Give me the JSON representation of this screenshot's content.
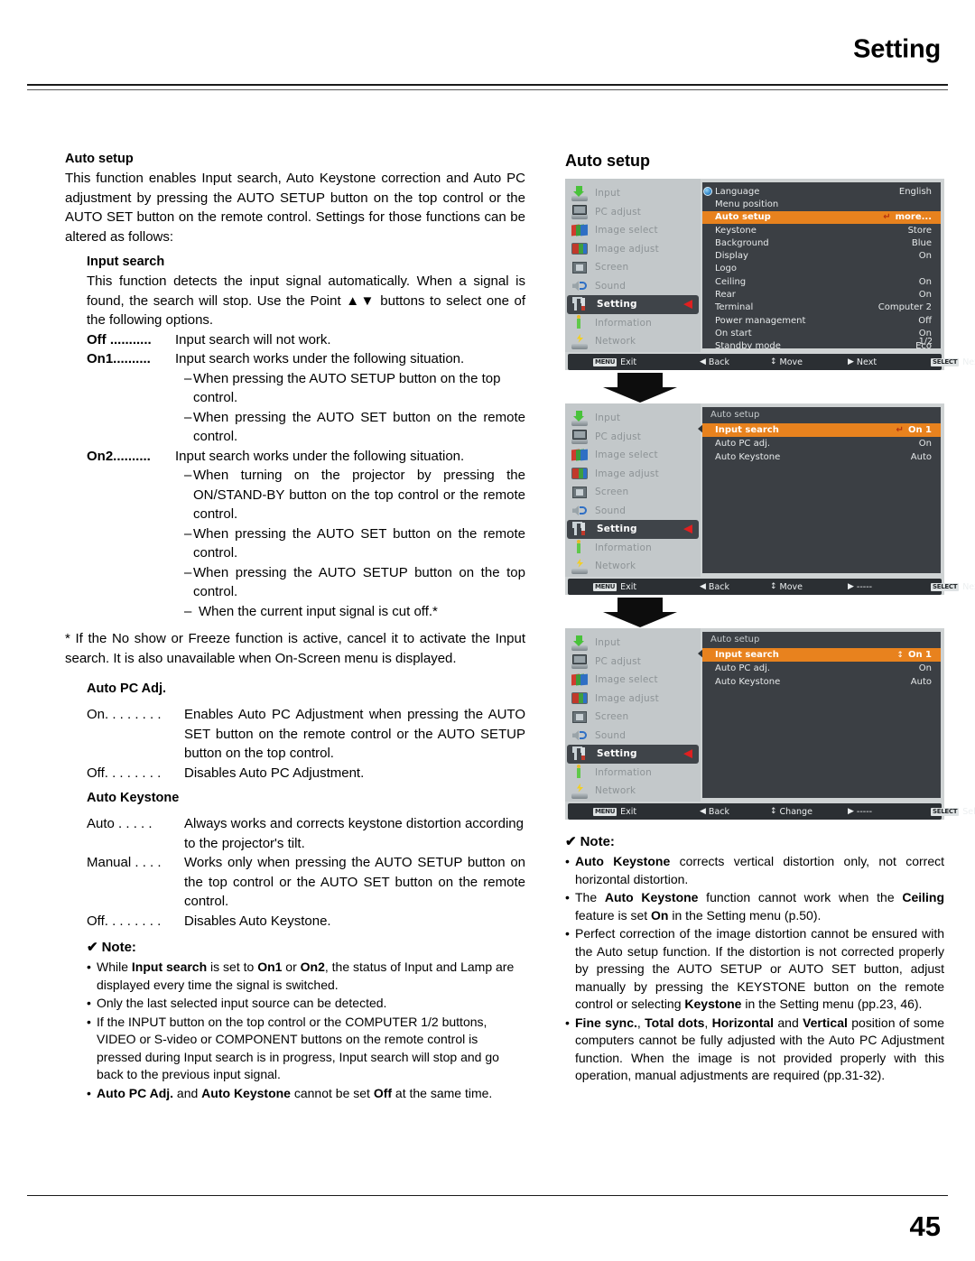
{
  "header": {
    "title": "Setting"
  },
  "footer": {
    "page_number": "45"
  },
  "left": {
    "heading": "Auto setup",
    "intro": "This function enables Input search, Auto Keystone correction and Auto PC adjustment by pressing the AUTO SETUP button on the top control or the AUTO SET button on the remote control. Settings for those functions can be altered as follows:",
    "input_search": {
      "heading": "Input search",
      "body": "This function detects the input signal automatically. When a signal is found, the search will stop. Use the Point ▲▼ buttons to select one of the following options.",
      "off_term": "Off ...........",
      "off_desc": "Input search will not work.",
      "on1_term": "On1..........",
      "on1_desc": "Input search works under the following situation.",
      "on1_items": [
        "When pressing the AUTO SETUP button on the top control.",
        "When pressing the AUTO SET button on the remote control."
      ],
      "on2_term": "On2..........",
      "on2_desc": "Input search works under the following situation.",
      "on2_items": [
        "When turning on the projector by pressing the ON/STAND-BY button on the top control or the remote control.",
        "When pressing the AUTO SET button on the remote control.",
        "When pressing the AUTO SETUP button on the top control.",
        "When the current input signal is cut off.*"
      ],
      "footnote": "* If the No show or Freeze function is active, cancel it to activate the Input search. It is also unavailable when On-Screen menu is displayed."
    },
    "auto_pc_adj": {
      "heading": "Auto PC Adj.",
      "on_term": "On. . . . . . . .",
      "on_desc": "Enables Auto PC Adjustment when pressing the AUTO SET button on the remote control or the AUTO SETUP button on the top control.",
      "off_term": "Off. . . . . . . .",
      "off_desc": "Disables Auto PC Adjustment."
    },
    "auto_keystone": {
      "heading": "Auto Keystone",
      "auto_term": "Auto . . . . .",
      "auto_desc": "Always works and corrects keystone distortion according to the projector's tilt.",
      "manual_term": "Manual . . . .",
      "manual_desc": "Works only when pressing the AUTO SETUP button on the top control or the AUTO SET button on the remote control.",
      "off_term": "Off. . . . . . . .",
      "off_desc": "Disables Auto Keystone."
    },
    "note": {
      "check": "✔",
      "heading": "Note:",
      "bullet_mark": "•",
      "items": [
        "While <b>Input search</b> is set to <b>On1</b> or <b>On2</b>, the status of Input and Lamp are displayed every time the signal is switched.",
        "Only the last selected input source can be detected.",
        "If the INPUT button on the top control or the COMPUTER 1/2 buttons, VIDEO or S-video or COMPONENT buttons on the remote control is pressed during Input search is in progress, Input search will stop and go back to the previous input signal.",
        "<b>Auto PC Adj.</b> and <b>Auto Keystone</b> cannot be set <b>Off</b> at the same time."
      ]
    }
  },
  "right": {
    "title": "Auto setup",
    "sidebar": [
      {
        "label": "Input",
        "icon": "input-icon",
        "selected": false
      },
      {
        "label": "PC adjust",
        "icon": "pc-adjust-icon",
        "selected": false
      },
      {
        "label": "Image select",
        "icon": "image-select-icon",
        "selected": false
      },
      {
        "label": "Image adjust",
        "icon": "image-adjust-icon",
        "selected": false
      },
      {
        "label": "Screen",
        "icon": "screen-icon",
        "selected": false
      },
      {
        "label": "Sound",
        "icon": "sound-icon",
        "selected": false
      },
      {
        "label": "Setting",
        "icon": "setting-icon",
        "selected": true
      },
      {
        "label": "Information",
        "icon": "information-icon",
        "selected": false
      },
      {
        "label": "Network",
        "icon": "network-icon",
        "selected": false
      }
    ],
    "menu1": {
      "rows": [
        {
          "label": "Language",
          "value": "English",
          "highlight": false,
          "globe": true
        },
        {
          "label": "Menu position",
          "value": "",
          "highlight": false
        },
        {
          "label": "Auto setup",
          "value": "more...",
          "highlight": true,
          "enter": "↵"
        },
        {
          "label": "Keystone",
          "value": "Store",
          "highlight": false
        },
        {
          "label": "Background",
          "value": "Blue",
          "highlight": false
        },
        {
          "label": "Display",
          "value": "On",
          "highlight": false
        },
        {
          "label": "Logo",
          "value": "",
          "highlight": false
        },
        {
          "label": "Ceiling",
          "value": "On",
          "highlight": false
        },
        {
          "label": "Rear",
          "value": "On",
          "highlight": false
        },
        {
          "label": "Terminal",
          "value": "Computer 2",
          "highlight": false
        },
        {
          "label": "Power management",
          "value": "Off",
          "highlight": false
        },
        {
          "label": "On start",
          "value": "On",
          "highlight": false
        },
        {
          "label": "Standby mode",
          "value": "Eco",
          "highlight": false
        }
      ],
      "page_indicator": "1/2",
      "bar": [
        {
          "key": "MENU",
          "label": "Exit"
        },
        {
          "glyph": "◀",
          "label": "Back"
        },
        {
          "glyph": "↕",
          "label": "Move"
        },
        {
          "glyph": "▶",
          "label": "Next"
        },
        {
          "key": "SELECT",
          "label": "Next"
        }
      ]
    },
    "menu2": {
      "sub_title": "Auto setup",
      "rows": [
        {
          "label": "Input search",
          "value": "On 1",
          "highlight": true,
          "enter": "↵"
        },
        {
          "label": "Auto PC adj.",
          "value": "On",
          "highlight": false
        },
        {
          "label": "Auto Keystone",
          "value": "Auto",
          "highlight": false
        }
      ],
      "bar": [
        {
          "key": "MENU",
          "label": "Exit"
        },
        {
          "glyph": "◀",
          "label": "Back"
        },
        {
          "glyph": "↕",
          "label": "Move"
        },
        {
          "glyph": "▶",
          "label": "-----"
        },
        {
          "key": "SELECT",
          "label": "Next"
        }
      ]
    },
    "menu3": {
      "sub_title": "Auto setup",
      "rows": [
        {
          "label": "Input search",
          "value": "On 1",
          "highlight": true,
          "updown": "↕"
        },
        {
          "label": "Auto PC adj.",
          "value": "On",
          "highlight": false
        },
        {
          "label": "Auto Keystone",
          "value": "Auto",
          "highlight": false
        }
      ],
      "bar": [
        {
          "key": "MENU",
          "label": "Exit"
        },
        {
          "glyph": "◀",
          "label": "Back"
        },
        {
          "glyph": "↕",
          "label": "Change"
        },
        {
          "glyph": "▶",
          "label": "-----"
        },
        {
          "key": "SELECT",
          "label": "Select"
        }
      ]
    },
    "note": {
      "check": "✔",
      "heading": "Note:",
      "bullet_mark": "•",
      "items": [
        "<b>Auto Keystone</b> corrects vertical distortion only, not correct horizontal distortion.",
        "The <b>Auto Keystone</b> function cannot work when the <b>Ceiling</b> feature is set <b>On</b> in the Setting menu (p.50).",
        "Perfect correction of the image distortion cannot be ensured with the Auto setup function. If the distortion is not corrected properly by pressing the AUTO SETUP or AUTO SET button, adjust manually by pressing the KEYSTONE button on the remote control or selecting <b>Keystone</b> in the Setting menu (pp.23, 46).",
        "<b>Fine sync.</b>, <b>Total dots</b>, <b>Horizontal</b> and <b>Vertical</b> position of some computers cannot be fully adjusted with the Auto PC Adjustment function. When the image is not provided properly with this operation, manual adjustments are required (pp.31-32)."
      ]
    }
  },
  "colors": {
    "highlight_orange": "#e8821e",
    "osd_panel_dark": "#3b3f44",
    "osd_sidebar": "#c3c8ca",
    "osd_bar": "#2b2f33",
    "caret_red": "#e02020"
  }
}
